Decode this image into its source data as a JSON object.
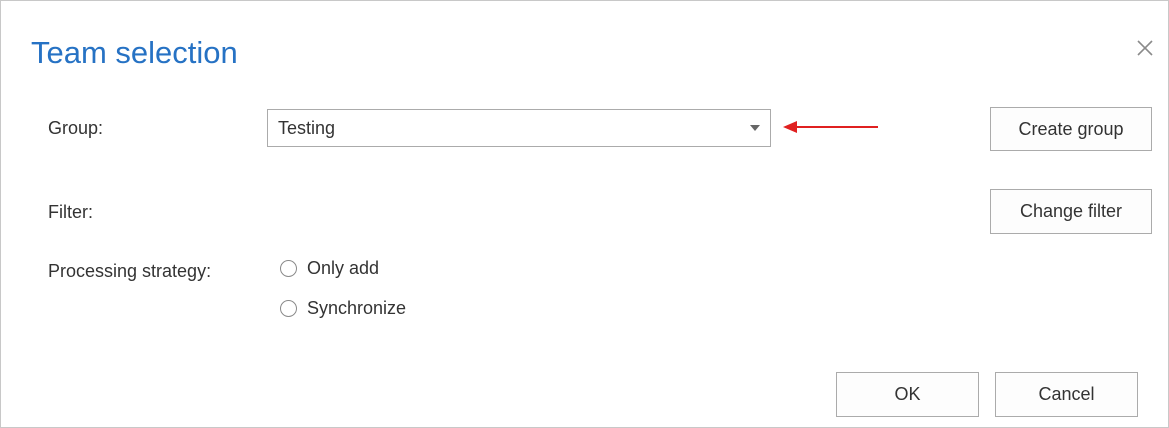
{
  "dialog": {
    "title": "Team selection",
    "close_icon": "close-icon"
  },
  "group": {
    "label": "Group:",
    "selected_value": "Testing",
    "create_button": "Create group",
    "annotation_arrow_color": "#e02020"
  },
  "filter": {
    "label": "Filter:",
    "change_button": "Change filter"
  },
  "processing": {
    "label": "Processing strategy:",
    "options": [
      {
        "label": "Only add",
        "selected": false
      },
      {
        "label": "Synchronize",
        "selected": false
      }
    ]
  },
  "footer": {
    "ok_label": "OK",
    "cancel_label": "Cancel"
  },
  "colors": {
    "title": "#2672c4",
    "border": "#ababab",
    "text": "#333333"
  }
}
